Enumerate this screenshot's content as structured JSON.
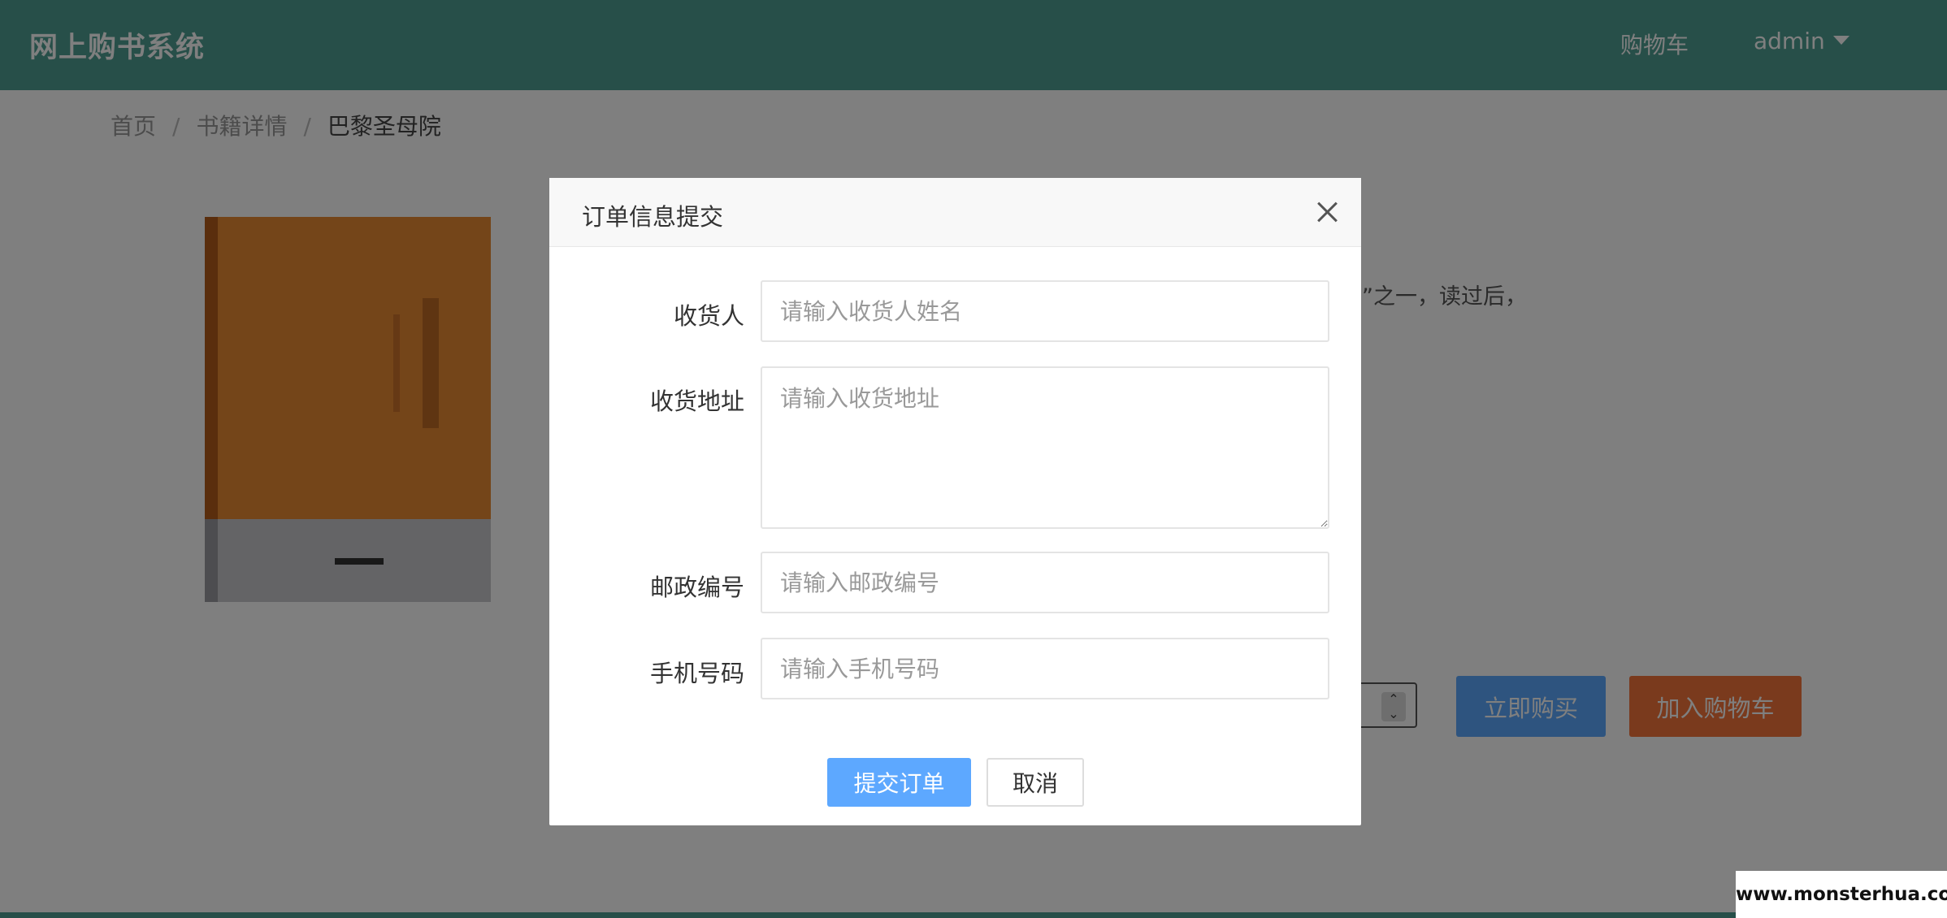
{
  "header": {
    "brand": "网上购书系统",
    "cart_link": "购物车",
    "user_menu": "admin"
  },
  "breadcrumb": {
    "home": "首页",
    "separator": "/",
    "detail": "书籍详情",
    "current": "巴黎圣母院"
  },
  "book": {
    "description_snippet": "”之一，读过后，",
    "buy_now_label": "立即购买",
    "add_to_cart_label": "加入购物车"
  },
  "modal": {
    "title": "订单信息提交",
    "fields": {
      "receiver": {
        "label": "收货人",
        "placeholder": "请输入收货人姓名",
        "value": ""
      },
      "address": {
        "label": "收货地址",
        "placeholder": "请输入收货地址",
        "value": ""
      },
      "postcode": {
        "label": "邮政编号",
        "placeholder": "请输入邮政编号",
        "value": ""
      },
      "phone": {
        "label": "手机号码",
        "placeholder": "请输入手机号码",
        "value": ""
      }
    },
    "submit_label": "提交订单",
    "cancel_label": "取消"
  },
  "watermark": "www.monsterhua.com",
  "colors": {
    "header": "#4f9f92",
    "primary": "#5da8ff",
    "accent": "#f5743a"
  },
  "icons": {
    "close": "close-icon",
    "dropdown": "caret-down-icon"
  }
}
